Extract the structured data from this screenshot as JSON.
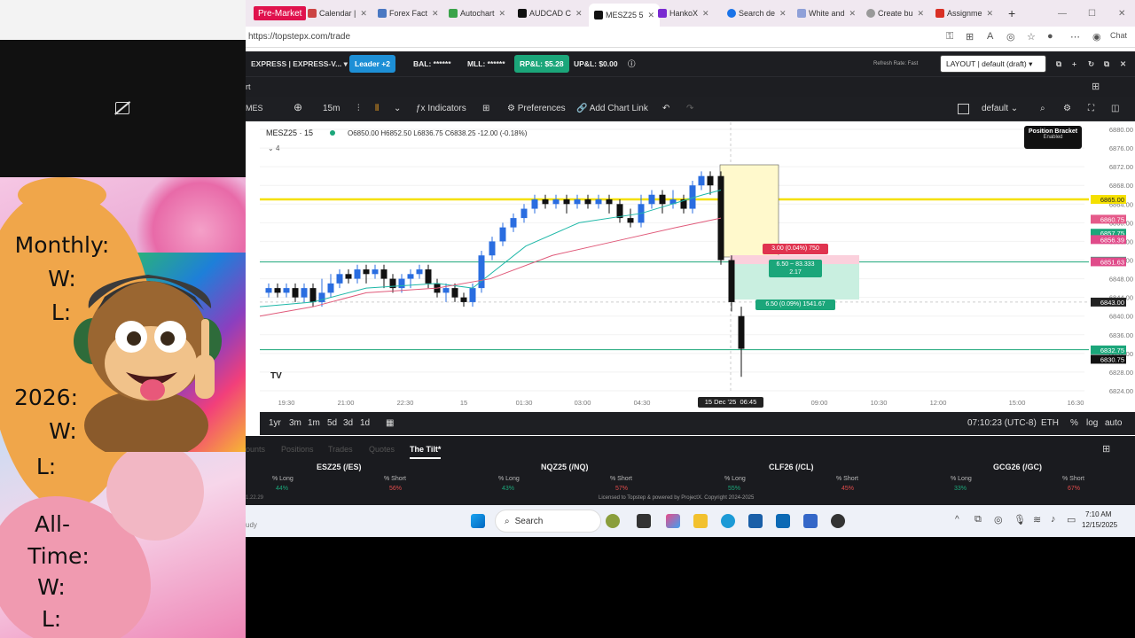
{
  "overlay": {
    "monthly": "Monthly:",
    "monthly_w": "W:",
    "monthly_l": "L:",
    "year": "2026:",
    "year_w": "W:",
    "year_l": "L:",
    "alltime_1": "All-",
    "alltime_2": "Time:",
    "alltime_w": "W:",
    "alltime_l": "L:"
  },
  "browser": {
    "tabs": [
      "Pre-Market",
      "Calendar |",
      "Forex Fact",
      "Autochart",
      "AUDCAD C",
      "MESZ25 5",
      "HankoX",
      "Search de",
      "White and",
      "Create bu",
      "Assignme"
    ],
    "url": "https://topstepx.com/trade",
    "chat": "Chat"
  },
  "app": {
    "account": "EXPRESS | EXPRESS-V...",
    "leader": "Leader +2",
    "bal": "BAL: ******",
    "mll": "MLL: ******",
    "rpl": "RP&L: $5.28",
    "upl": "UP&L: $0.00",
    "refresh": "Refresh Rate: Fast",
    "layout": "LAYOUT | default (draft)",
    "row2_label": "rt"
  },
  "toolbar": {
    "symbol_tab": "MES",
    "interval": "15m",
    "indicators": "Indicators",
    "preferences": "Preferences",
    "add_chart_link": "Add Chart Link",
    "default_layout": "default"
  },
  "chart": {
    "symbol": "MESZ25 · 15",
    "ohlc": "O6850.00 H6852.50 L6836.75 C6838.25 -12.00 (-0.18%)",
    "indicator_count": "4",
    "position_bracket": "Position Bracket",
    "position_bracket_state": "Enabled",
    "risk_label": "3.00 (0.04%) 750",
    "entry_label": "6.50 ~ 83.333",
    "entry_label2": "2.17",
    "target_label": "6.50 (0.09%) 1541.67",
    "price_ticks": [
      "6880.00",
      "6876.00",
      "6872.00",
      "6868.00",
      "6864.00",
      "6860.00",
      "6856.00",
      "6852.00",
      "6848.00",
      "6844.00",
      "6840.00",
      "6836.00",
      "6832.00",
      "6828.00",
      "6824.00"
    ],
    "price_badges": [
      {
        "v": "6865.00",
        "c": "#f5e000",
        "t": "#222"
      },
      {
        "v": "6860.75",
        "c": "#e55a8a",
        "t": "#fff"
      },
      {
        "v": "6857.75",
        "c": "#1ba67a",
        "t": "#fff"
      },
      {
        "v": "6856.39",
        "c": "#e04b8a",
        "t": "#fff"
      },
      {
        "v": "6851.75",
        "c": "#1ba67a",
        "t": "#fff"
      },
      {
        "v": "6851.63",
        "c": "#e04b8a",
        "t": "#fff"
      },
      {
        "v": "6843.00",
        "c": "#222",
        "t": "#fff"
      },
      {
        "v": "6832.75",
        "c": "#1ba67a",
        "t": "#fff"
      },
      {
        "v": "6830.75",
        "c": "#111",
        "t": "#fff"
      }
    ],
    "time_ticks": [
      "19:30",
      "21:00",
      "22:30",
      "15",
      "01:30",
      "03:00",
      "04:30",
      "09:00",
      "10:30",
      "12:00",
      "15:00",
      "16:30"
    ],
    "crosshair_date": "15 Dec '25",
    "crosshair_time": "06:45",
    "colors": {
      "bull": "#2a6de0",
      "bear": "#111111",
      "yellow": "#f5e000",
      "green": "#1ba67a",
      "red": "#e04b8a"
    }
  },
  "timeframes": [
    "1yr",
    "3m",
    "1m",
    "5d",
    "3d",
    "1d"
  ],
  "clock": "07:10:23 (UTC-8)",
  "session": "ETH",
  "scale_opts": [
    "%",
    "log",
    "auto"
  ],
  "bottom": {
    "tabs": [
      "ounts",
      "Positions",
      "Trades",
      "Quotes",
      "The Tilt*"
    ],
    "symbols": [
      {
        "name": "ESZ25 (/ES)",
        "long_pct": "44%",
        "short_pct": "56%"
      },
      {
        "name": "NQZ25 (/NQ)",
        "long_pct": "43%",
        "short_pct": "57%"
      },
      {
        "name": "CLF26 (/CL)",
        "long_pct": "55%",
        "short_pct": "45%"
      },
      {
        "name": "GCG26 (/GC)",
        "long_pct": "33%",
        "short_pct": "67%"
      }
    ],
    "long_label": "% Long",
    "short_label": "% Short",
    "license": "Licensed to Topstep & powered by ProjectX. Copyright 2024-2025",
    "version": "1.22.29"
  },
  "taskbar": {
    "search": "Search",
    "time": "7:10 AM",
    "date": "12/15/2025",
    "left_text": "udy"
  }
}
